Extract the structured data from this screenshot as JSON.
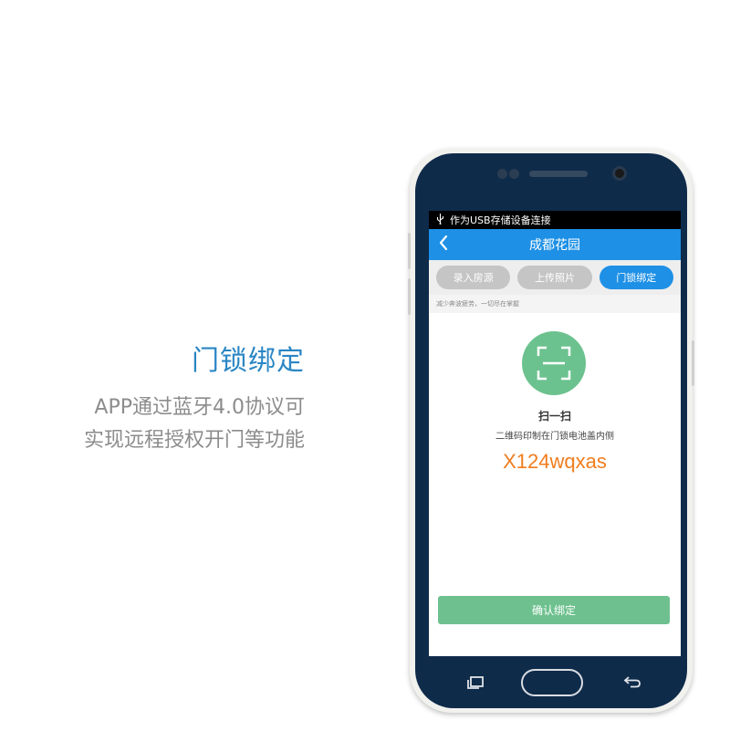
{
  "promo": {
    "title": "门锁绑定",
    "line1": "APP通过蓝牙4.0协议可",
    "line2": "实现远程授权开门等功能"
  },
  "status_bar": {
    "usb_icon": "usb-icon",
    "text": "作为USB存储设备连接"
  },
  "nav": {
    "back_icon": "chevron-left-icon",
    "title": "成都花园"
  },
  "tabs": [
    {
      "label": "录入房源",
      "active": false
    },
    {
      "label": "上传照片",
      "active": false
    },
    {
      "label": "门锁绑定",
      "active": true
    }
  ],
  "hint": "减少奔波疲劳，一切尽在掌握",
  "scan": {
    "icon": "qr-scan-icon",
    "title": "扫一扫",
    "description": "二维码印制在门锁电池盖内侧",
    "code": "X124wqxas"
  },
  "confirm_button": "确认绑定",
  "colors": {
    "primary": "#1e90e6",
    "accent_green": "#6cc28f",
    "code_orange": "#f07d1e",
    "promo_title": "#2a86c4",
    "phone_body": "#0f2b4a"
  }
}
